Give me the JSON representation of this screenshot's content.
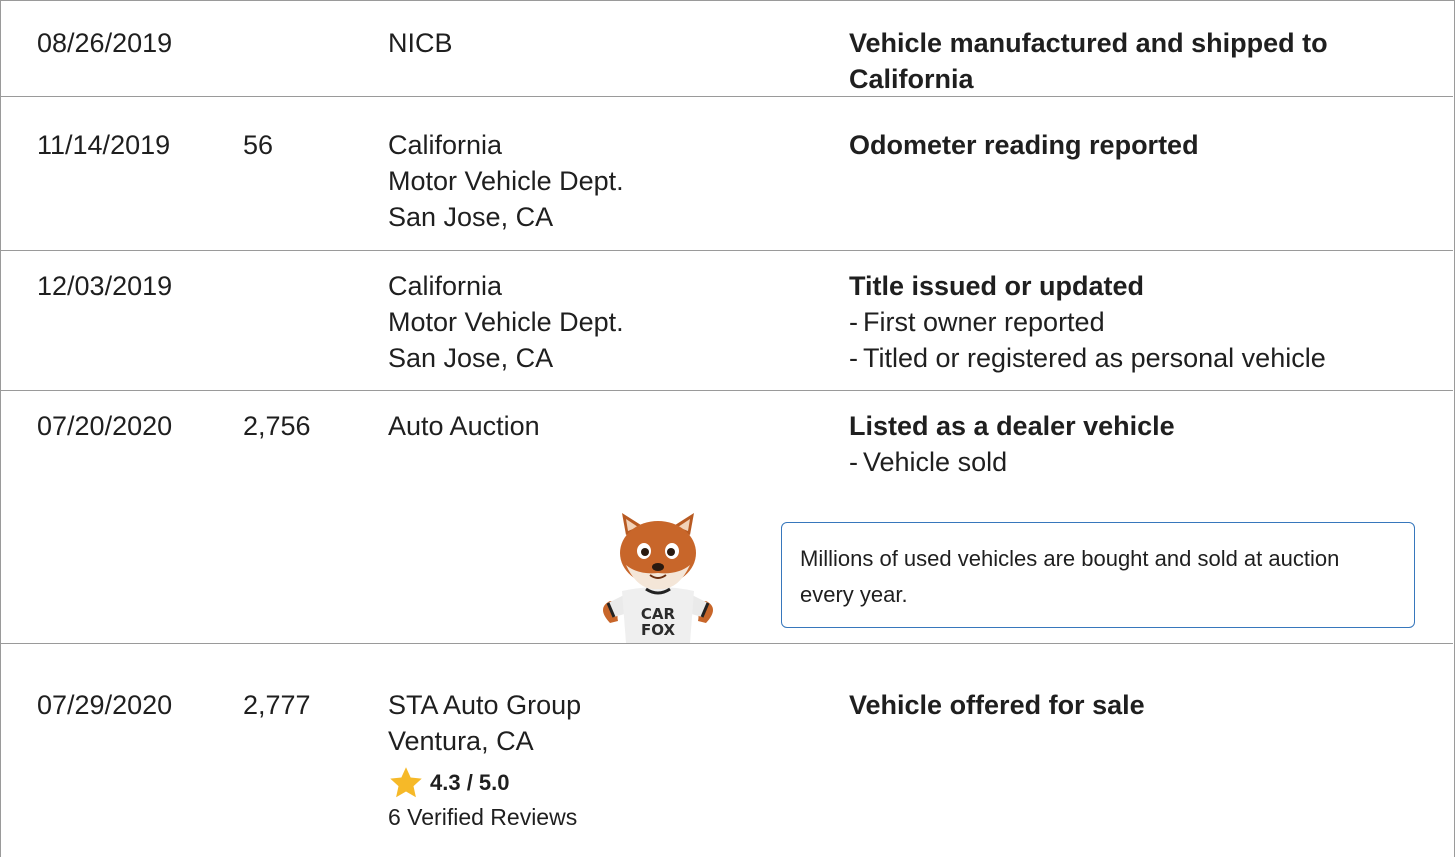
{
  "records": [
    {
      "date": "08/26/2019",
      "odometer": "",
      "source": [
        "NICB"
      ],
      "title_lines": [
        "Vehicle manufactured and shipped to",
        "California"
      ],
      "details": []
    },
    {
      "date": "11/14/2019",
      "odometer": "56",
      "source": [
        "California",
        "Motor Vehicle Dept.",
        "San Jose, CA"
      ],
      "title_lines": [
        "Odometer reading reported"
      ],
      "details": []
    },
    {
      "date": "12/03/2019",
      "odometer": "",
      "source": [
        "California",
        "Motor Vehicle Dept.",
        "San Jose, CA"
      ],
      "title_lines": [
        "Title issued or updated"
      ],
      "details": [
        "First owner reported",
        "Titled or registered as personal vehicle"
      ]
    },
    {
      "date": "07/20/2020",
      "odometer": "2,756",
      "source": [
        "Auto Auction"
      ],
      "title_lines": [
        "Listed as a dealer vehicle"
      ],
      "details": [
        "Vehicle sold"
      ]
    },
    {
      "date": "07/29/2020",
      "odometer": "2,777",
      "source": [
        "STA Auto Group",
        "Ventura, CA"
      ],
      "title_lines": [
        "Vehicle offered for sale"
      ],
      "details": [],
      "rating": "4.3 / 5.0",
      "reviews": "6 Verified Reviews"
    }
  ],
  "fox_tip": {
    "text": "Millions of used vehicles are bought and sold at auction every year.",
    "shirt_line1": "CAR",
    "shirt_line2": "FOX"
  },
  "colors": {
    "border": "#9a9a9a",
    "tip_border": "#3777bc",
    "star": "#f6b928",
    "fox_fur": "#c8662a"
  },
  "dash": "-"
}
